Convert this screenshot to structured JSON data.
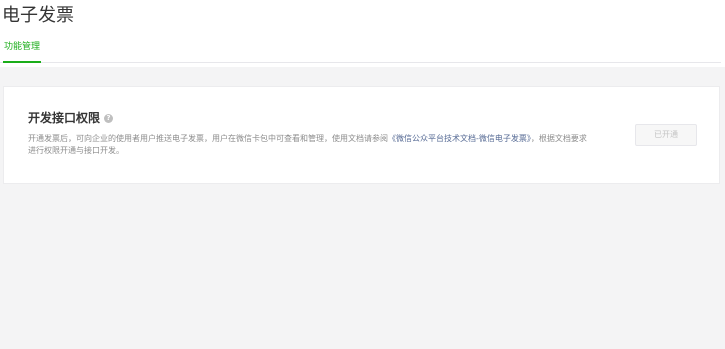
{
  "header": {
    "title": "电子发票"
  },
  "tabs": [
    {
      "label": "功能管理",
      "active": true
    }
  ],
  "card": {
    "title": "开发接口权限",
    "help_icon": "question-circle-icon",
    "desc_before": "开通发票后，可向企业的使用者用户推送电子发票，用户在微信卡包中可查看和管理，使用文档请参阅",
    "desc_link": "《微信公众平台技术文档-微信电子发票》",
    "desc_after": "，根据文档要求进行权限开通与接口开发。",
    "button_label": "已开通",
    "button_disabled": true
  },
  "colors": {
    "accent": "#1aad19",
    "link": "#576b95",
    "text": "#353535",
    "muted": "#8d8d8d"
  }
}
